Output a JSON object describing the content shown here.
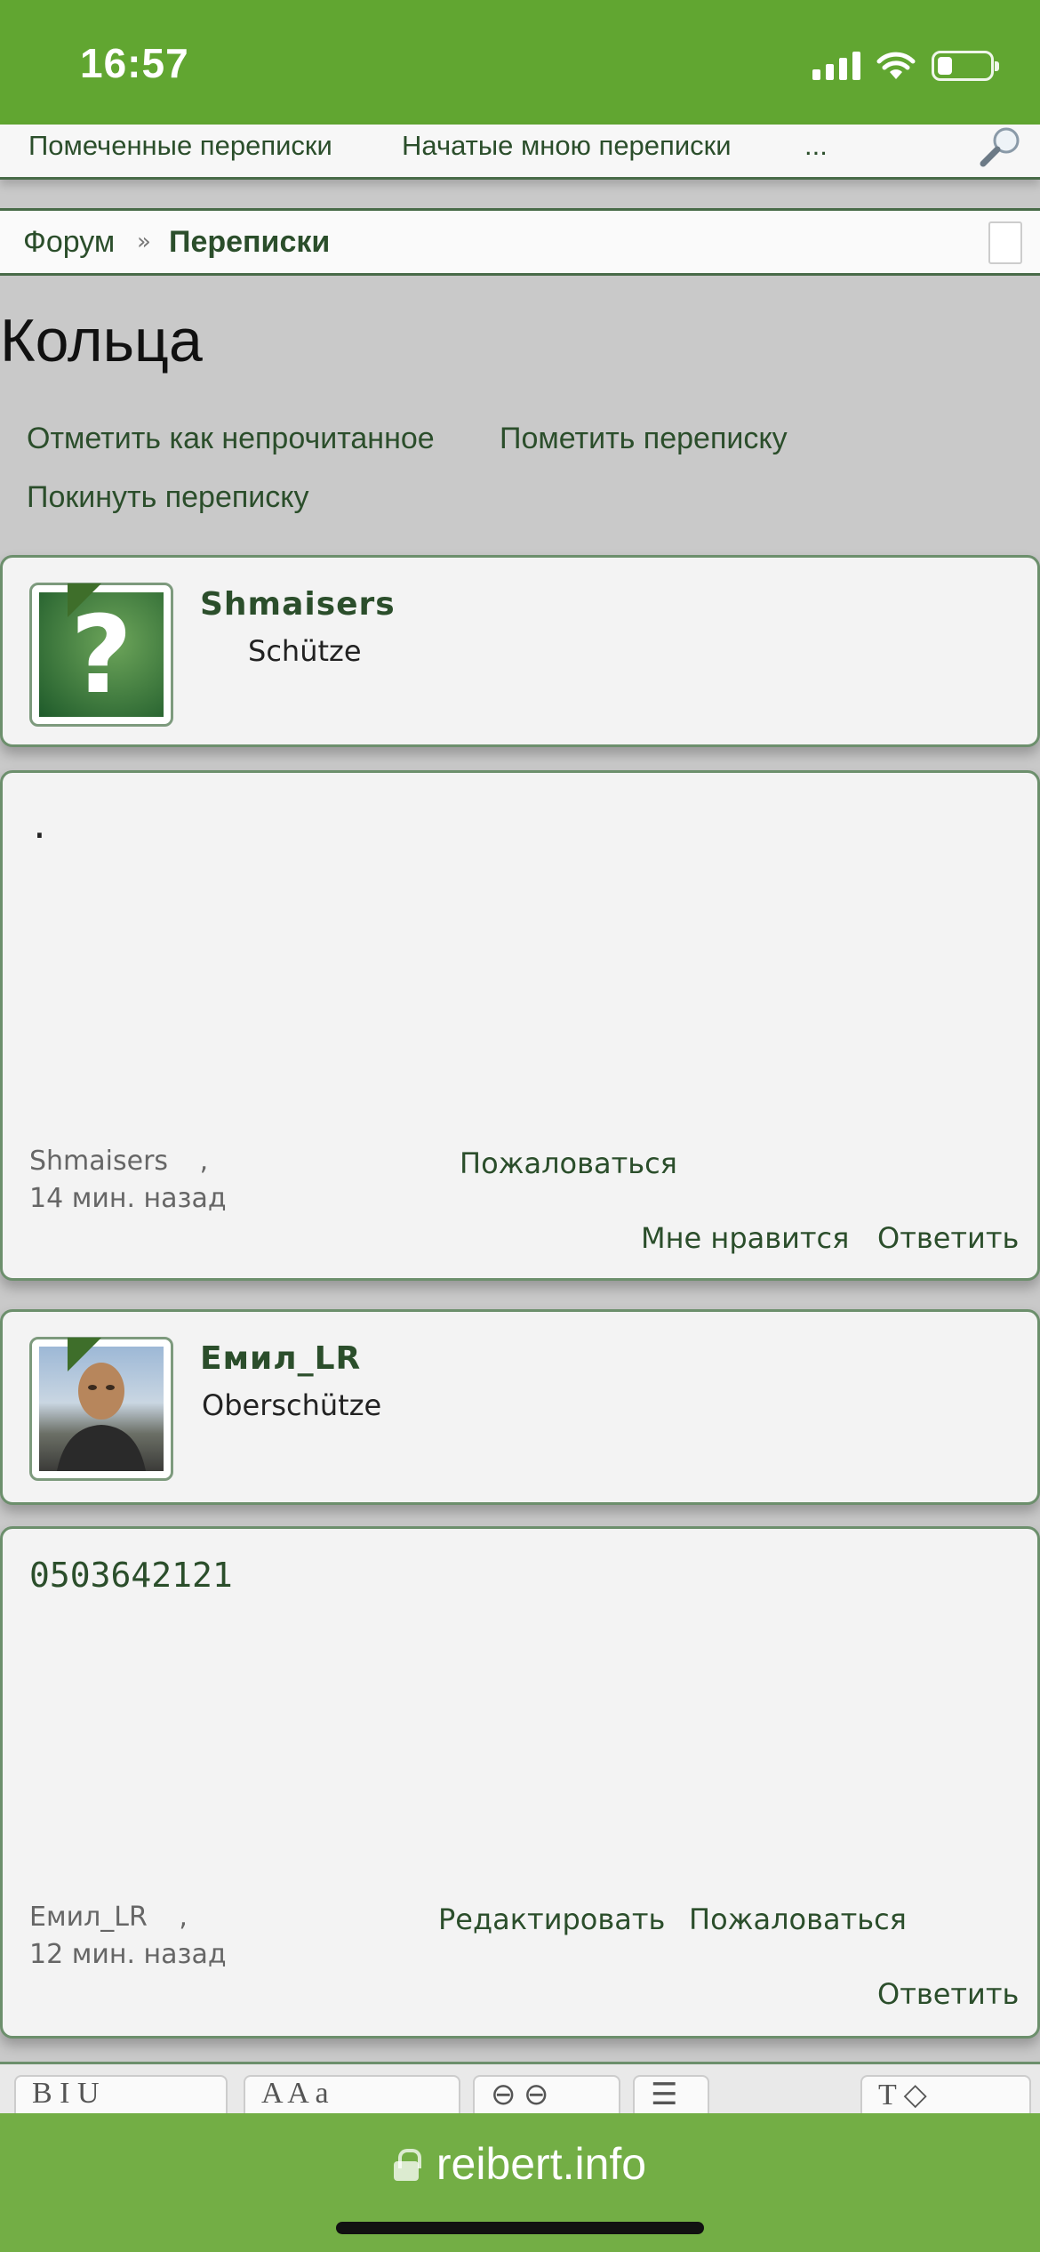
{
  "status_bar": {
    "time": "16:57"
  },
  "top_nav": {
    "links": [
      "Помеченные переписки",
      "Начатые мною переписки",
      "..."
    ]
  },
  "breadcrumb": {
    "root": "Форум",
    "separator": "»",
    "current": "Переписки"
  },
  "conversation": {
    "title": "Кольца",
    "actions": {
      "mark_unread": "Отметить как непрочитанное",
      "star": "Пометить переписку",
      "leave": "Покинуть переписку"
    }
  },
  "messages": [
    {
      "author": "Shmaisers",
      "user_title": "Schütze",
      "text": ".",
      "meta_author": "Shmaisers",
      "meta_comma": ",",
      "time": "14 мин. назад",
      "report": "Пожаловаться",
      "like": "Мне нравится",
      "reply": "Ответить"
    },
    {
      "author": "Емил_LR",
      "user_title": "Oberschütze",
      "text": "0503642121",
      "meta_author": "Емил_LR",
      "meta_comma": ",",
      "time": "12 мин. назад",
      "edit": "Редактировать",
      "report": "Пожаловаться",
      "reply": "Ответить"
    }
  ],
  "editor_toolbar": {
    "groups": [
      "B I U",
      "A A a",
      "⊖ ⊖",
      "☰",
      "T ◇"
    ]
  },
  "browser": {
    "url": "reibert.info"
  },
  "colors": {
    "accent": "#61a631",
    "link": "#2b4e2b",
    "border": "#6c8f6c"
  }
}
